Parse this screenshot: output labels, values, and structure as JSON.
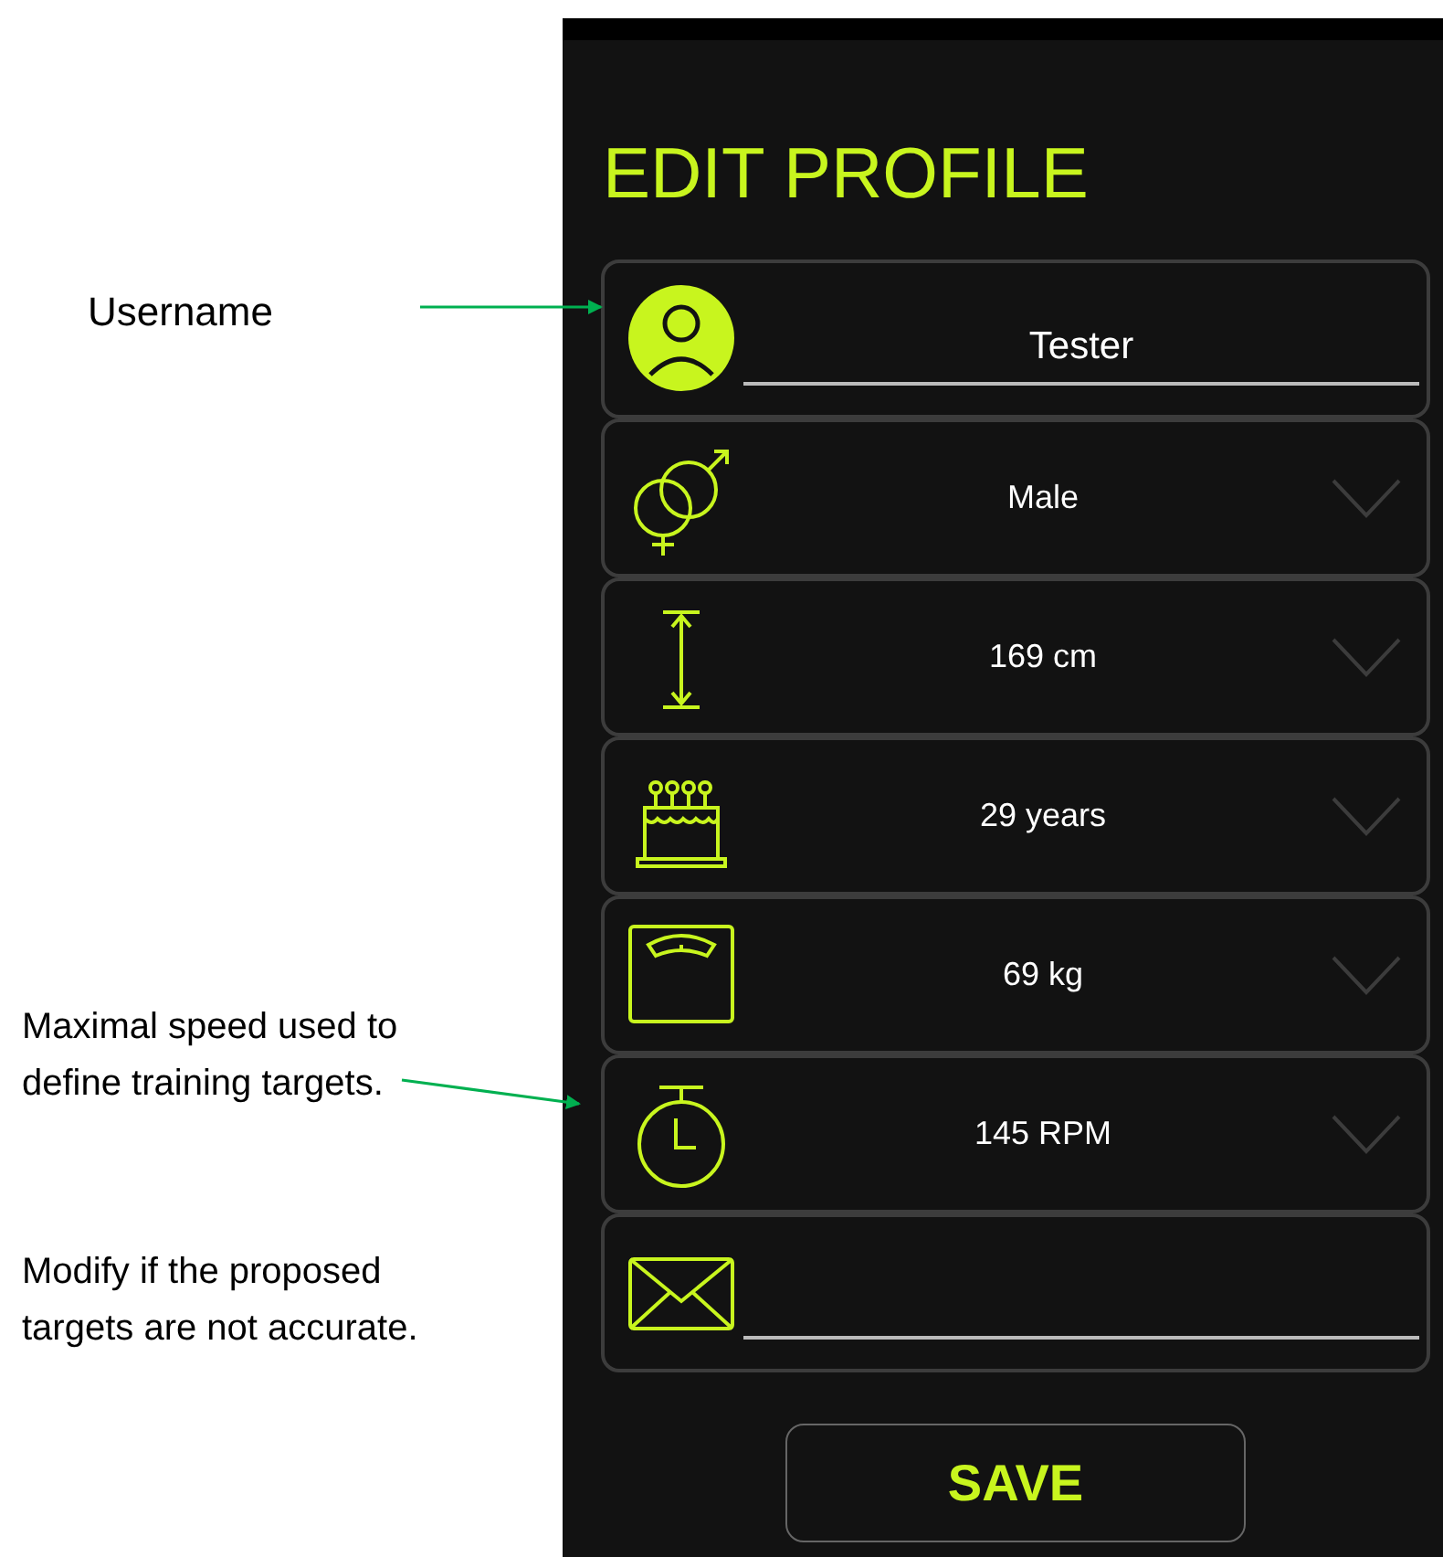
{
  "annotations": [
    {
      "kind": "arrow",
      "text": "Username"
    },
    {
      "kind": "arrow",
      "text": "Maximal speed used to define training targets."
    },
    {
      "kind": "note",
      "text": "Modify if the proposed targets are not accurate."
    }
  ],
  "screen": {
    "title": "EDIT PROFILE",
    "fields": [
      {
        "kind": "input",
        "value": "Tester"
      },
      {
        "kind": "dropdown",
        "value": "Male"
      },
      {
        "kind": "dropdown",
        "value": "169 cm"
      },
      {
        "kind": "dropdown",
        "value": "29 years"
      },
      {
        "kind": "dropdown",
        "value": "69 kg"
      },
      {
        "kind": "dropdown",
        "value": "145 RPM"
      },
      {
        "kind": "input"
      }
    ],
    "save_button": "SAVE"
  }
}
